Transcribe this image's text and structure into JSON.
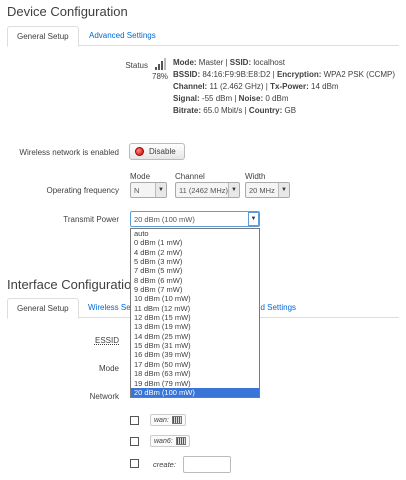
{
  "device": {
    "title": "Device Configuration",
    "tabs": [
      "General Setup",
      "Advanced Settings"
    ]
  },
  "status": {
    "label": "Status",
    "signal_percent": "78%",
    "mode_key": "Mode:",
    "mode_val": "Master",
    "ssid_key": "SSID:",
    "ssid_val": "localhost",
    "bssid_key": "BSSID:",
    "bssid_val": "84:16:F9:9B:E8:D2",
    "enc_key": "Encryption:",
    "enc_val": "WPA2 PSK (CCMP)",
    "channel_key": "Channel:",
    "channel_val": "11 (2.462 GHz)",
    "txp_key": "Tx-Power:",
    "txp_val": "14 dBm",
    "signal_key": "Signal:",
    "signal_val": "-55 dBm",
    "noise_key": "Noise:",
    "noise_val": "0 dBm",
    "bitrate_key": "Bitrate:",
    "bitrate_val": "65.0 Mbit/s",
    "country_key": "Country:",
    "country_val": "GB"
  },
  "wireless": {
    "label": "Wireless network is enabled",
    "button": "Disable"
  },
  "frequency": {
    "label": "Operating frequency",
    "mode_header": "Mode",
    "channel_header": "Channel",
    "width_header": "Width",
    "mode_value": "N",
    "channel_value": "11 (2462 MHz)",
    "width_value": "20 MHz"
  },
  "transmit": {
    "label": "Transmit Power",
    "value": "20 dBm (100 mW)",
    "options": [
      "auto",
      "0 dBm (1 mW)",
      "4 dBm (2 mW)",
      "5 dBm (3 mW)",
      "7 dBm (5 mW)",
      "8 dBm (6 mW)",
      "9 dBm (7 mW)",
      "10 dBm (10 mW)",
      "11 dBm (12 mW)",
      "12 dBm (15 mW)",
      "13 dBm (19 mW)",
      "14 dBm (25 mW)",
      "15 dBm (31 mW)",
      "16 dBm (39 mW)",
      "17 dBm (50 mW)",
      "18 dBm (63 mW)",
      "19 dBm (79 mW)",
      "20 dBm (100 mW)"
    ],
    "selected_index": 17
  },
  "interface": {
    "title": "Interface Configuration",
    "tab_general": "General Setup",
    "tab_wireless": "Wireless Se",
    "tab_advanced": "ed Settings",
    "essid_label": "ESSID",
    "mode_label": "Mode",
    "network_label": "Network",
    "networks": [
      {
        "name": "wan:"
      },
      {
        "name": "wan6:"
      }
    ],
    "create_label": "create:"
  },
  "colors": {
    "link": "#0069d6",
    "selected_option": "#3875d7",
    "danger": "#cc0000"
  }
}
